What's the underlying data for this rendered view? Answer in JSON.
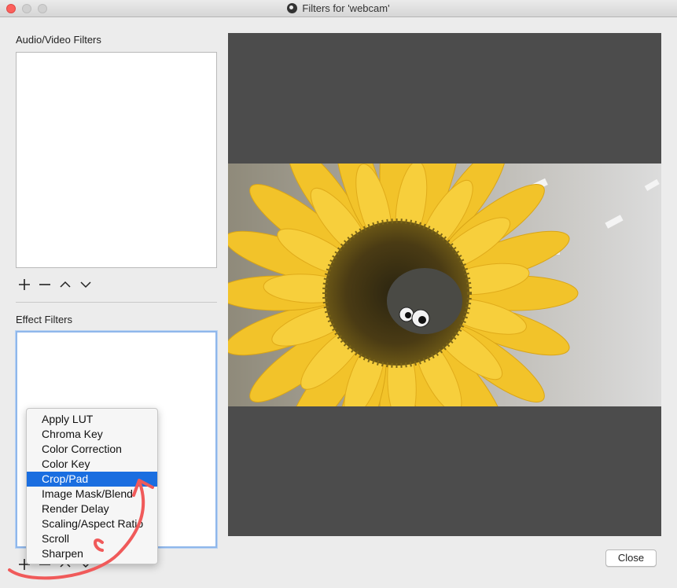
{
  "window": {
    "title": "Filters for 'webcam'"
  },
  "audio_video_filters": {
    "label": "Audio/Video Filters",
    "items": []
  },
  "effect_filters": {
    "label": "Effect Filters",
    "items": []
  },
  "add_filter_menu": {
    "items": [
      {
        "label": "Apply LUT",
        "selected": false
      },
      {
        "label": "Chroma Key",
        "selected": false
      },
      {
        "label": "Color Correction",
        "selected": false
      },
      {
        "label": "Color Key",
        "selected": false
      },
      {
        "label": "Crop/Pad",
        "selected": true
      },
      {
        "label": "Image Mask/Blend",
        "selected": false
      },
      {
        "label": "Render Delay",
        "selected": false
      },
      {
        "label": "Scaling/Aspect Ratio",
        "selected": false
      },
      {
        "label": "Scroll",
        "selected": false
      },
      {
        "label": "Sharpen",
        "selected": false
      }
    ]
  },
  "buttons": {
    "close": "Close"
  },
  "icons": {
    "add": "plus-icon",
    "remove": "minus-icon",
    "move_up": "chevron-up-icon",
    "move_down": "chevron-down-icon"
  },
  "colors": {
    "selection": "#1a6ee0",
    "annotation": "#f05a5a",
    "focus_ring": "#8fb7eb"
  }
}
